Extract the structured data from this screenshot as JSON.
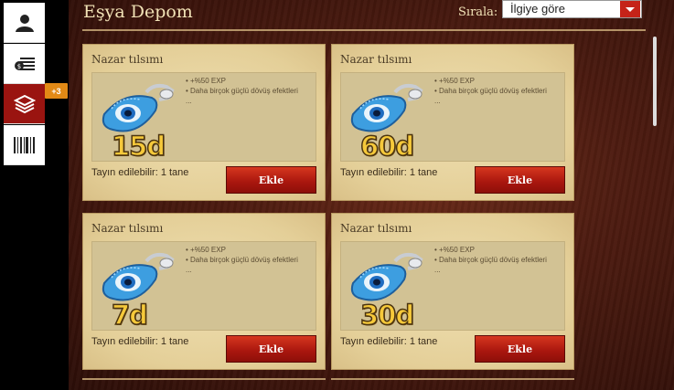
{
  "sidebar": {
    "items": [
      {
        "icon": "user-icon"
      },
      {
        "icon": "money-stack-icon"
      },
      {
        "icon": "layers-icon",
        "active": true,
        "badge": "+3"
      },
      {
        "icon": "barcode-icon"
      }
    ]
  },
  "header": {
    "title": "Eşya Depom",
    "sort_label": "Sırala:",
    "sort_value": "İlgiye göre"
  },
  "cards": [
    {
      "title": "Nazar tılsımı",
      "days": "15d",
      "desc1": "• +%50 EXP",
      "desc2": "• Daha birçok güçlü dövüş efektleri",
      "desc3": "...",
      "assign": "Tayın edilebilir: 1 tane",
      "button": "Ekle"
    },
    {
      "title": "Nazar tılsımı",
      "days": "60d",
      "desc1": "• +%50 EXP",
      "desc2": "• Daha birçok güçlü dövüş efektleri",
      "desc3": "...",
      "assign": "Tayın edilebilir: 1 tane",
      "button": "Ekle"
    },
    {
      "title": "Nazar tılsımı",
      "days": "7d",
      "desc1": "• +%50 EXP",
      "desc2": "• Daha birçok güçlü dövüş efektleri",
      "desc3": "...",
      "assign": "Tayın edilebilir: 1 tane",
      "button": "Ekle"
    },
    {
      "title": "Nazar tılsımı",
      "days": "30d",
      "desc1": "• +%50 EXP",
      "desc2": "• Daha birçok güçlü dövüş efektleri",
      "desc3": "...",
      "assign": "Tayın edilebilir: 1 tane",
      "button": "Ekle"
    }
  ]
}
